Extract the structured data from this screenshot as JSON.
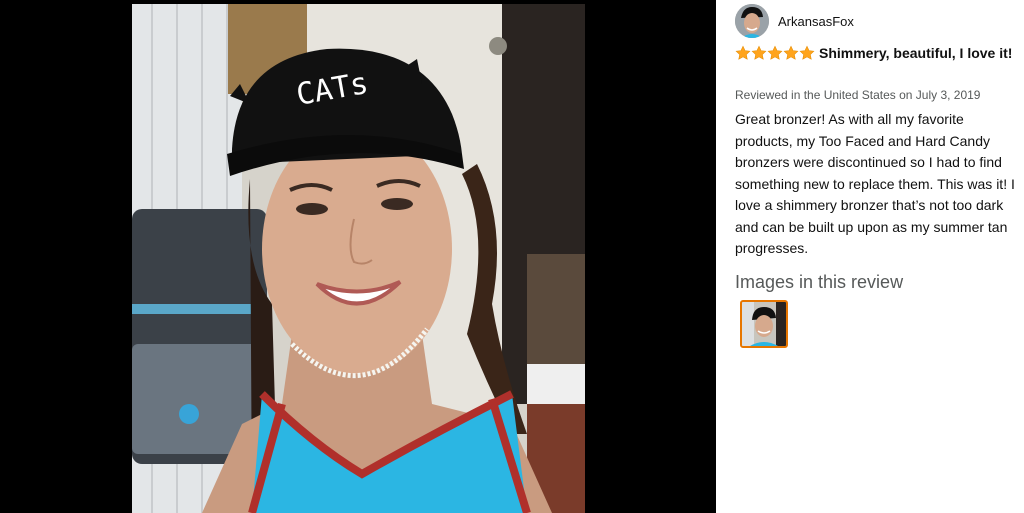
{
  "review": {
    "reviewer_name": "ArkansasFox",
    "rating": 5,
    "rating_max": 5,
    "title": "Shimmery, beautiful, I love it!",
    "date_line": "Reviewed in the United States on July 3, 2019",
    "body": "Great bronzer! As with all my favorite products, my Too Faced and Hard Candy bronzers were discontinued so I had to find something new to replace them. This was it! I love a shimmery bronzer that’s not too dark and can be built up upon as my summer tan progresses.",
    "images_heading": "Images in this review",
    "photo_cap_text": "CATs"
  },
  "colors": {
    "star": "#ffa41c",
    "thumb_border": "#e77600",
    "muted_text": "#565959",
    "backdrop": "#000000"
  },
  "icons": {
    "star": "star-icon"
  }
}
